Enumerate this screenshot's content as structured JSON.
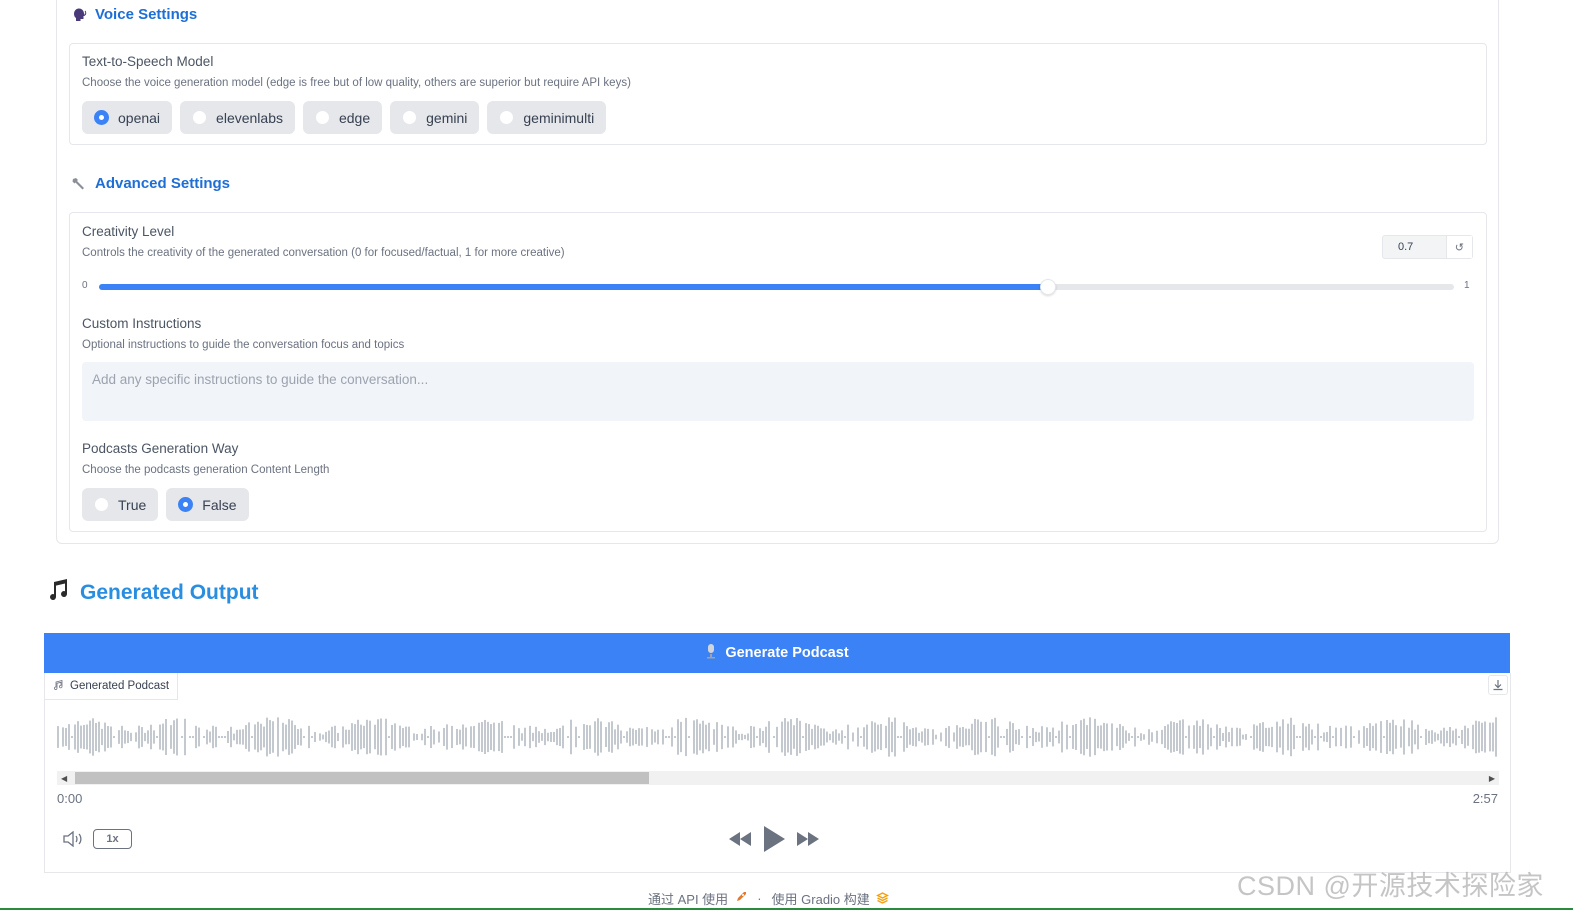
{
  "voice_settings": {
    "title": "Voice Settings",
    "tts_label": "Text-to-Speech Model",
    "tts_info": "Choose the voice generation model (edge is free but of low quality, others are superior but require API keys)",
    "options": [
      "openai",
      "elevenlabs",
      "edge",
      "gemini",
      "geminimulti"
    ],
    "selected": "openai"
  },
  "advanced_settings": {
    "title": "Advanced Settings",
    "creativity_label": "Creativity Level",
    "creativity_info": "Controls the creativity of the generated conversation (0 for focused/factual, 1 for more creative)",
    "creativity_value": "0.7",
    "creativity_fraction": 0.7,
    "slider_min": "0",
    "slider_max": "1",
    "custom_label": "Custom Instructions",
    "custom_info": "Optional instructions to guide the conversation focus and topics",
    "custom_placeholder": "Add any specific instructions to guide the conversation...",
    "way_label": "Podcasts Generation Way",
    "way_info": "Choose the podcasts generation Content Length",
    "way_options": [
      "True",
      "False"
    ],
    "way_selected": "False"
  },
  "output": {
    "title": "Generated Output",
    "generate_button": "Generate Podcast",
    "audio_label": "Generated Podcast",
    "time_current": "0:00",
    "time_total": "2:57",
    "playback_rate": "1x",
    "scroll_fraction": 0.4
  },
  "footer": {
    "api_text": "通过 API 使用",
    "separator": "·",
    "gradio_text": "使用 Gradio 构建"
  },
  "watermark": "CSDN @开源技术探险家",
  "colors": {
    "accent": "#3b82f6",
    "heading": "#1d6fd6",
    "output_title": "#2a8ee0"
  }
}
